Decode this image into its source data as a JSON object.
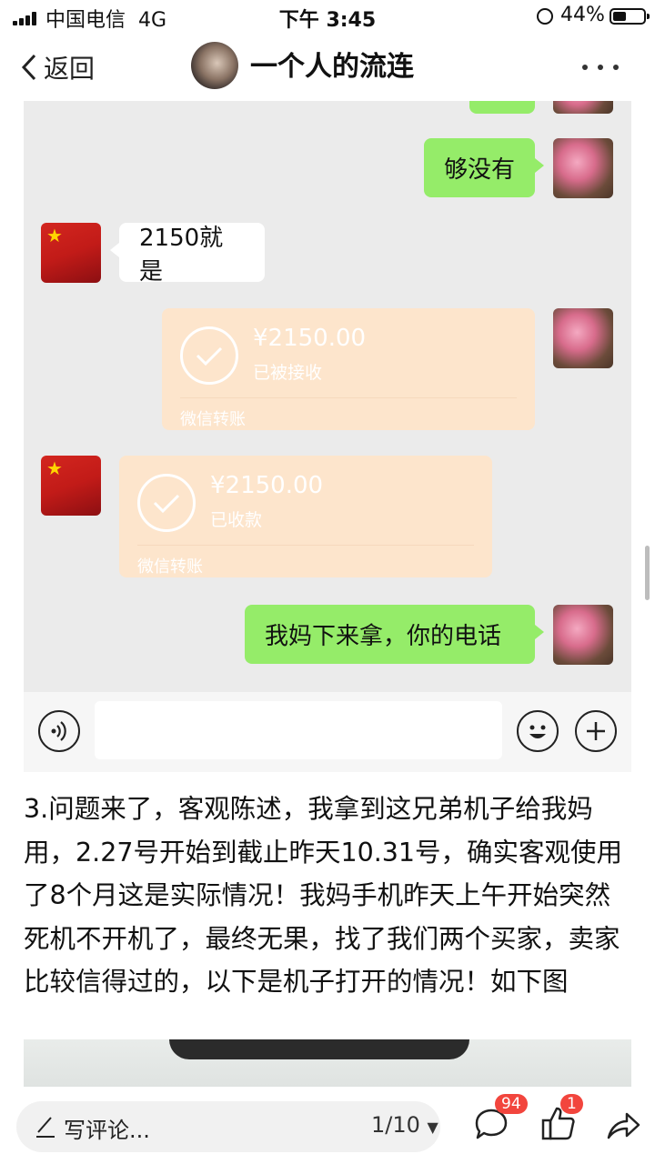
{
  "status_bar": {
    "carrier": "中国电信",
    "network": "4G",
    "time": "下午 3:45",
    "battery_pct": "44%",
    "battery_level": 0.44
  },
  "nav": {
    "back_label": "返回",
    "title": "一个人的流连",
    "more_icon": "more-icon"
  },
  "chat": {
    "msg1": "够没有",
    "msg2": "2150就是",
    "transfer1": {
      "amount": "¥2150.00",
      "status": "已被接收",
      "footer": "微信转账"
    },
    "transfer2": {
      "amount": "¥2150.00",
      "status": "已收款",
      "footer": "微信转账"
    },
    "msg3": "我妈下来拿，你的电话"
  },
  "post": {
    "text": "3.问题来了，客观陈述，我拿到这兄弟机子给我妈用，2.27号开始到截止昨天10.31号，确实客观使用了8个月这是实际情况！我妈手机昨天上午开始突然死机不开机了，最终无果，找了我们两个买家，卖家比较信得过的，以下是机子打开的情况！如下图"
  },
  "bottom_bar": {
    "comment_placeholder": "写评论...",
    "pager": "1/10",
    "comment_count": "94",
    "like_count": "1"
  },
  "colors": {
    "green_bubble": "#95ec69",
    "transfer_bg": "#fde5cc",
    "badge": "#f2453d"
  }
}
